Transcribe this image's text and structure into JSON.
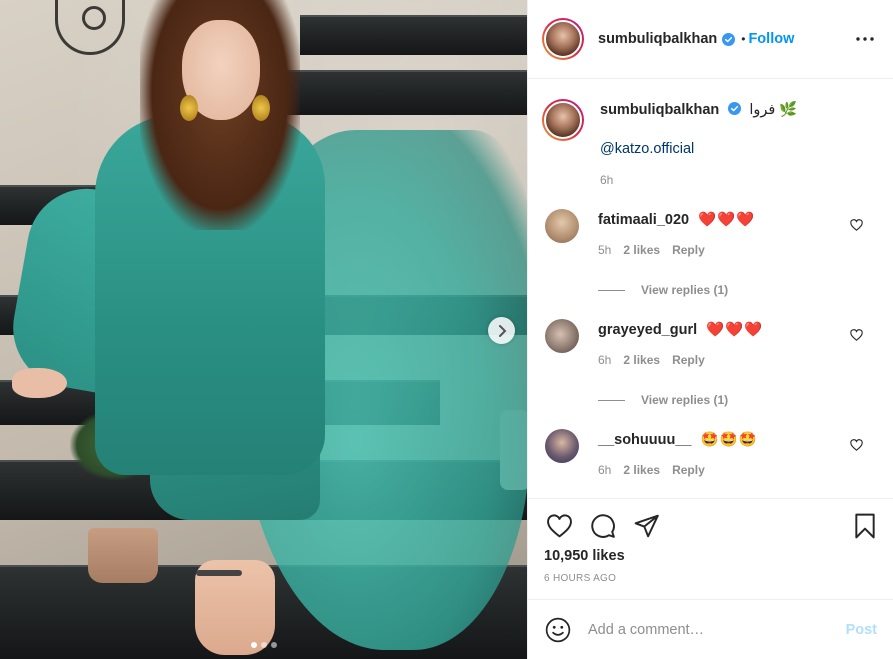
{
  "author": {
    "username": "sumbuliqbalkhan",
    "follow_label": "Follow"
  },
  "caption": {
    "text": "فروا 🌿",
    "mention": "@katzo.official",
    "time": "6h"
  },
  "comments": [
    {
      "username": "fatimaali_020",
      "text": "❤️❤️❤️",
      "time": "5h",
      "likes": "2 likes",
      "reply_label": "Reply",
      "view_replies": "View replies (1)",
      "avatar_color": "#c7a88a"
    },
    {
      "username": "grayeyed_gurl",
      "text": "❤️❤️❤️",
      "time": "6h",
      "likes": "2 likes",
      "reply_label": "Reply",
      "view_replies": "View replies (1)",
      "avatar_color": "#8a7f7a"
    },
    {
      "username": "__sohuuuu__",
      "text": "🤩🤩🤩",
      "time": "6h",
      "likes": "2 likes",
      "reply_label": "Reply",
      "avatar_color": "#3d4a6b"
    }
  ],
  "stats": {
    "likes": "10,950 likes",
    "ago": "6 HOURS AGO"
  },
  "comment_box": {
    "placeholder": "Add a comment…",
    "post_label": "Post"
  },
  "carousel": {
    "total_slides": 3,
    "current_slide": 1
  },
  "colors": {
    "accent": "#0095f6",
    "muted": "#8e8e8e",
    "post_disabled": "#b2dffc",
    "heart": "#ed4956"
  },
  "icons": [
    "verified-badge-icon",
    "more-options-icon",
    "like-icon",
    "comment-icon",
    "share-icon",
    "bookmark-icon",
    "emoji-icon",
    "chevron-right-icon",
    "small-heart-icon"
  ]
}
